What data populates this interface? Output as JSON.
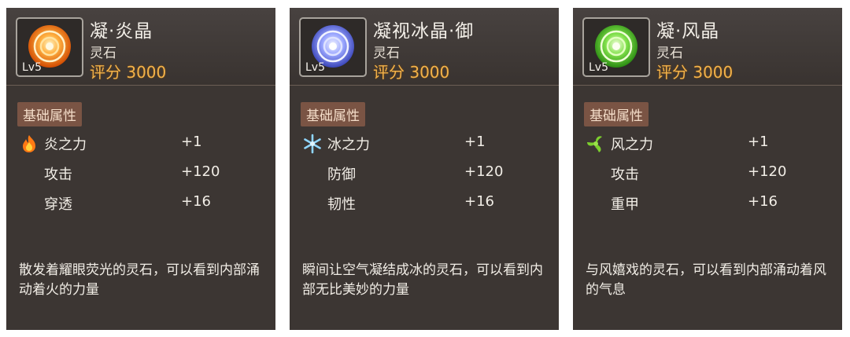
{
  "cards": [
    {
      "name": "凝·炎晶",
      "type": "灵石",
      "level": "Lv5",
      "score": "评分 3000",
      "section": "基础属性",
      "stone_color": "#ff8a1c",
      "element_icon": "fire-icon",
      "stats": [
        {
          "label": "炎之力",
          "value": "+1"
        },
        {
          "label": "攻击",
          "value": "+120"
        },
        {
          "label": "穿透",
          "value": "+16"
        }
      ],
      "desc": "散发着耀眼荧光的灵石，可以看到内部涌动着火的力量"
    },
    {
      "name": "凝视冰晶·御",
      "type": "灵石",
      "level": "Lv5",
      "score": "评分 3000",
      "section": "基础属性",
      "stone_color": "#7f8ff4",
      "element_icon": "snowflake-icon",
      "stats": [
        {
          "label": "冰之力",
          "value": "+1"
        },
        {
          "label": "防御",
          "value": "+120"
        },
        {
          "label": "韧性",
          "value": "+16"
        }
      ],
      "desc": "瞬间让空气凝结成冰的灵石，可以看到内部无比美妙的力量"
    },
    {
      "name": "凝·风晶",
      "type": "灵石",
      "level": "Lv5",
      "score": "评分 3000",
      "section": "基础属性",
      "stone_color": "#5fd43a",
      "element_icon": "wind-icon",
      "stats": [
        {
          "label": "风之力",
          "value": "+1"
        },
        {
          "label": "攻击",
          "value": "+120"
        },
        {
          "label": "重甲",
          "value": "+16"
        }
      ],
      "desc": "与风嬉戏的灵石，可以看到内部涌动着风的气息"
    }
  ]
}
